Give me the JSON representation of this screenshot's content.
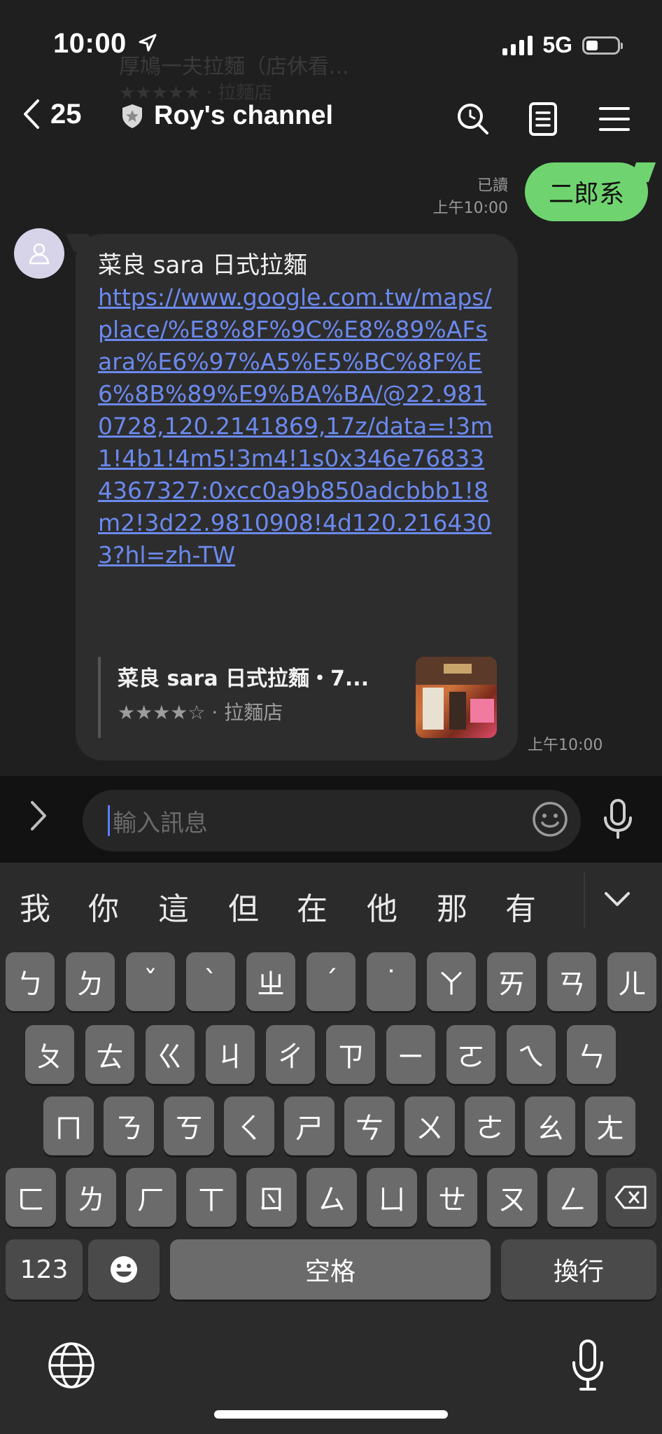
{
  "status": {
    "time": "10:00",
    "network": "5G"
  },
  "background_ghost": {
    "line1": "厚鳩一夫拉麵（店休看...",
    "line2": "★★★★★ · 拉麵店"
  },
  "header": {
    "back_count": "25",
    "title": "Roy's channel"
  },
  "messages": {
    "sent": {
      "text": "二郎系",
      "read_label": "已讀",
      "time": "上午10:00"
    },
    "received": {
      "head": "菜良 sara 日式拉麵",
      "link": "https://www.google.com.tw/maps/place/%E8%8F%9C%E8%89%AFsara%E6%97%A5%E5%BC%8F%E6%8B%89%E9%BA%BA/@22.9810728,120.2141869,17z/data=!3m1!4b1!4m5!3m4!1s0x346e768334367327:0xcc0a9b850adcbbb1!8m2!3d22.9810908!4d120.2164303?hl=zh-TW",
      "preview_title": "菜良 sara 日式拉麵・7...",
      "preview_stars": "★★★★☆",
      "preview_category": " · 拉麵店",
      "time": "上午10:00"
    }
  },
  "input": {
    "placeholder": "輸入訊息"
  },
  "keyboard": {
    "candidates": [
      "我",
      "你",
      "這",
      "但",
      "在",
      "他",
      "那",
      "有"
    ],
    "row1": [
      "ㄅ",
      "ㄉ",
      "ˇ",
      "ˋ",
      "ㄓ",
      "ˊ",
      "˙",
      "ㄚ",
      "ㄞ",
      "ㄢ",
      "ㄦ"
    ],
    "row2": [
      "ㄆ",
      "ㄊ",
      "ㄍ",
      "ㄐ",
      "ㄔ",
      "ㄗ",
      "ㄧ",
      "ㄛ",
      "ㄟ",
      "ㄣ"
    ],
    "row3": [
      "ㄇ",
      "ㄋ",
      "ㄎ",
      "ㄑ",
      "ㄕ",
      "ㄘ",
      "ㄨ",
      "ㄜ",
      "ㄠ",
      "ㄤ"
    ],
    "row4": [
      "ㄈ",
      "ㄌ",
      "ㄏ",
      "ㄒ",
      "ㄖ",
      "ㄙ",
      "ㄩ",
      "ㄝ",
      "ㄡ",
      "ㄥ"
    ],
    "numbers_label": "123",
    "space_label": "空格",
    "return_label": "換行"
  }
}
